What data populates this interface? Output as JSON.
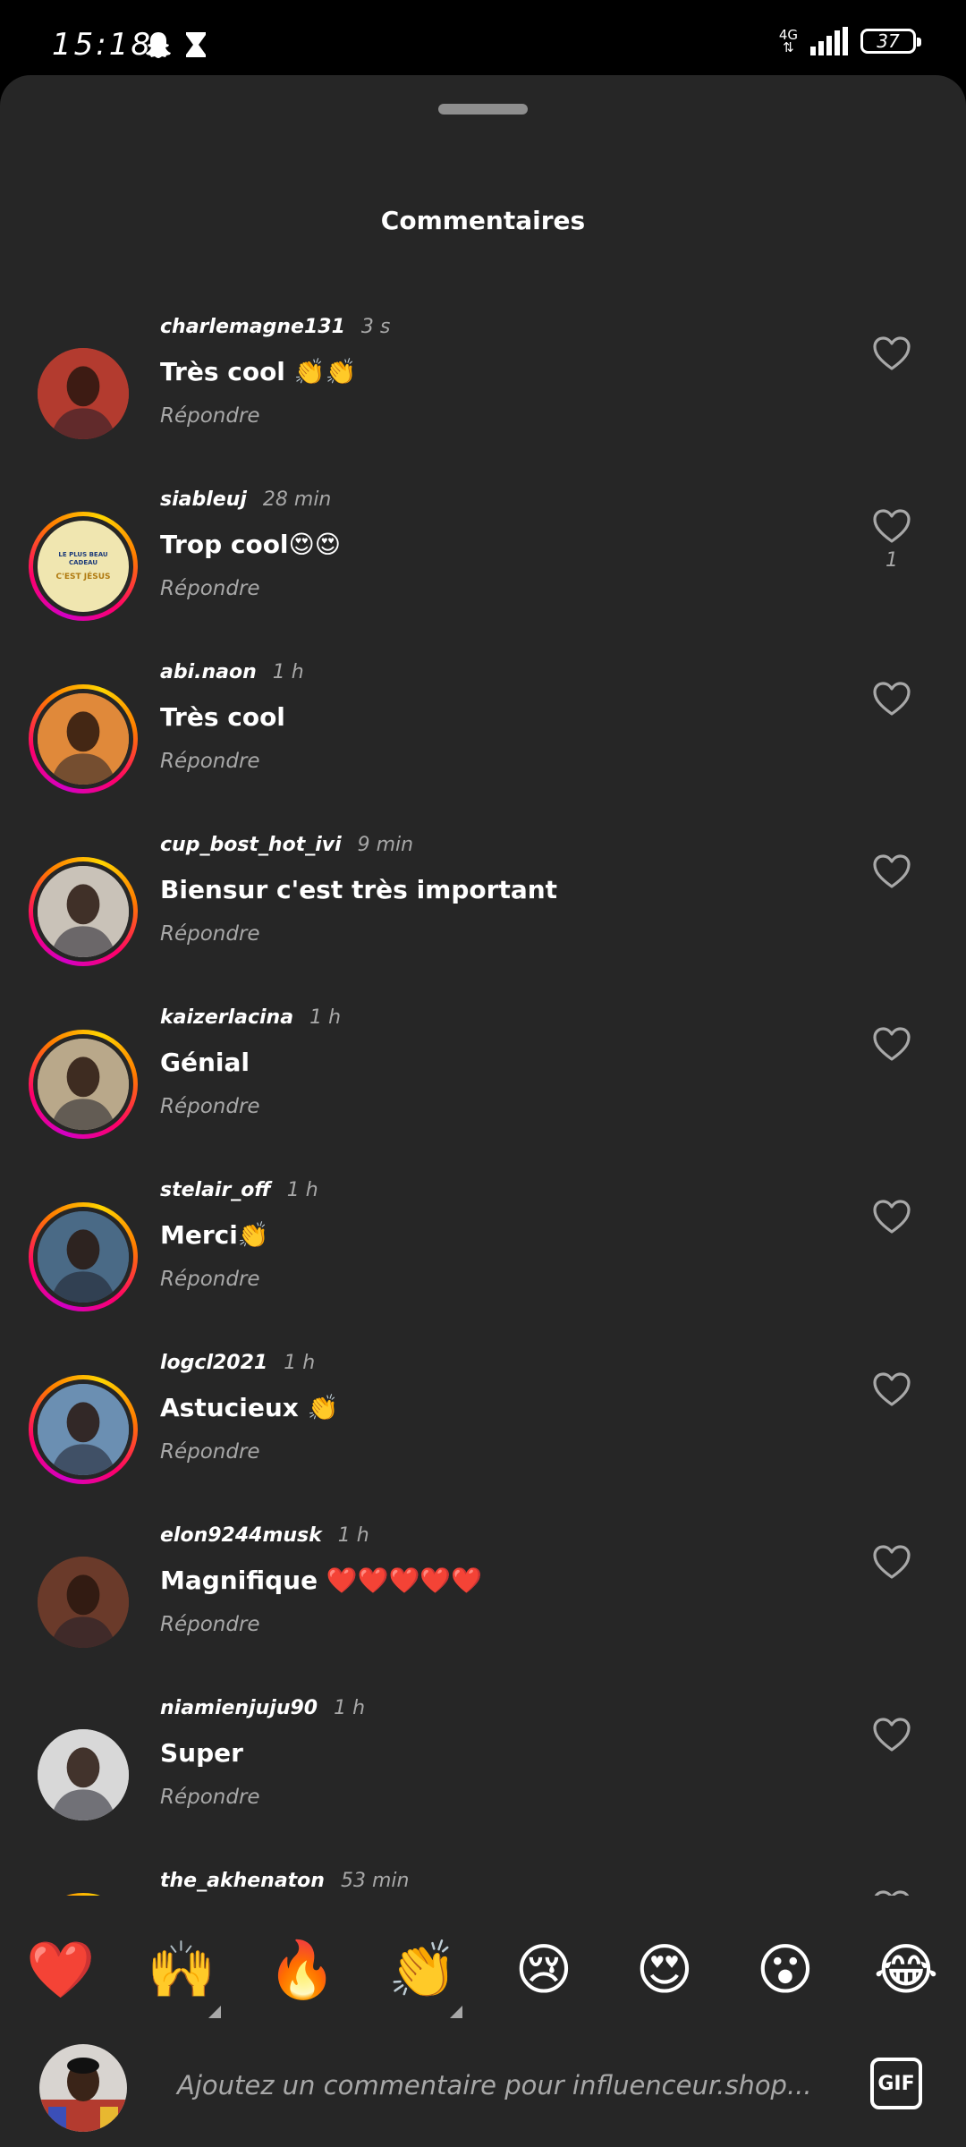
{
  "status_bar": {
    "time": "15:18",
    "network": "4G",
    "battery": "37",
    "left_icons": [
      "snapchat-icon",
      "hourglass-icon"
    ]
  },
  "sheet": {
    "title": "Commentaires"
  },
  "reply_label": "Répondre",
  "comments": [
    {
      "username": "charlemagne131",
      "time": "3 s",
      "text": "Très cool 👏👏",
      "likes": "",
      "ring": false,
      "avatar_color": "#b33b2f"
    },
    {
      "username": "siableuj",
      "time": "28 min",
      "text": "Trop cool😍😍",
      "likes": "1",
      "ring": true,
      "avatar_color": "#f0e6b0",
      "avatar_lettering": [
        "LE PLUS BEAU CADEAU",
        "C'EST JÉSUS"
      ]
    },
    {
      "username": "abi.naon",
      "time": "1 h",
      "text": "Très cool",
      "likes": "",
      "ring": true,
      "avatar_color": "#e0893a"
    },
    {
      "username": "cup_bost_hot_ivi",
      "time": "9 min",
      "text": "Biensur c'est très important",
      "likes": "",
      "ring": true,
      "avatar_color": "#c9c2b8"
    },
    {
      "username": "kaizerlacina",
      "time": "1 h",
      "text": "Génial",
      "likes": "",
      "ring": true,
      "avatar_color": "#b9a88a"
    },
    {
      "username": "stelair_off",
      "time": "1 h",
      "text": "Merci👏",
      "likes": "",
      "ring": true,
      "avatar_color": "#4a6a86"
    },
    {
      "username": "logcl2021",
      "time": "1 h",
      "text": "Astucieux 👏",
      "likes": "",
      "ring": true,
      "avatar_color": "#6b8fb2"
    },
    {
      "username": "elon9244musk",
      "time": "1 h",
      "text": "Magnifique ❤️❤️❤️❤️❤️",
      "likes": "",
      "ring": false,
      "avatar_color": "#6a3a2a"
    },
    {
      "username": "niamienjuju90",
      "time": "1 h",
      "text": "Super",
      "likes": "",
      "ring": false,
      "avatar_color": "#d8d8d8"
    },
    {
      "username": "the_akhenaton",
      "time": "53 min",
      "text": "",
      "likes": "",
      "ring": true,
      "avatar_color": "#7a6a3a"
    }
  ],
  "quick_reactions": [
    "❤️",
    "🙌",
    "🔥",
    "👏",
    "😢",
    "😍",
    "😮",
    "😂"
  ],
  "input": {
    "placeholder": "Ajoutez un commentaire pour influenceur.shop...",
    "gif_label": "GIF"
  },
  "colors": {
    "sheet_background": "#262626",
    "secondary_text": "#a8a8a8",
    "status_background": "#000000"
  }
}
